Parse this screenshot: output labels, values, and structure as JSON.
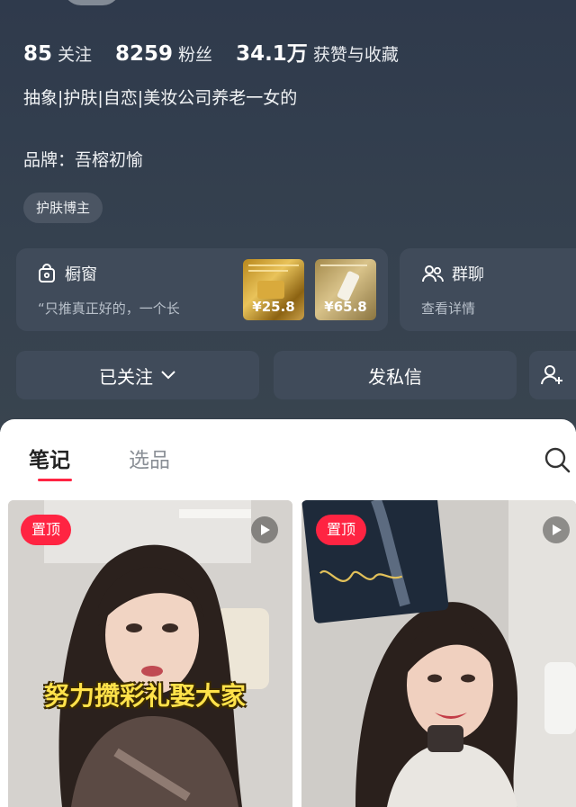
{
  "profile": {
    "stats": [
      {
        "num": "85",
        "label": "关注"
      },
      {
        "num": "8259",
        "label": "粉丝"
      },
      {
        "num": "34.1万",
        "label": "获赞与收藏"
      }
    ],
    "bio": "抽象|护肤|自恋|美妆公司养老一女的",
    "brand": "品牌：吾榕初愉",
    "tag": "护肤博主"
  },
  "shop": {
    "icon": "bag-icon",
    "title": "橱窗",
    "subtitle": "“只推真正好的，一个长",
    "products": [
      {
        "price": "¥25.8"
      },
      {
        "price": "¥65.8"
      }
    ]
  },
  "group": {
    "icon": "group-icon",
    "title": "群聊",
    "subtitle": "查看详情"
  },
  "actions": {
    "follow": "已关注",
    "message": "发私信"
  },
  "tabs": [
    {
      "label": "笔记"
    },
    {
      "label": "选品"
    }
  ],
  "notes": [
    {
      "pin": "置顶",
      "caption": "努力攒彩礼娶大家"
    },
    {
      "pin": "置顶"
    }
  ],
  "colors": {
    "accent": "#ff2442",
    "header_bg": "#333e4d",
    "card_bg": "#404b5a"
  }
}
